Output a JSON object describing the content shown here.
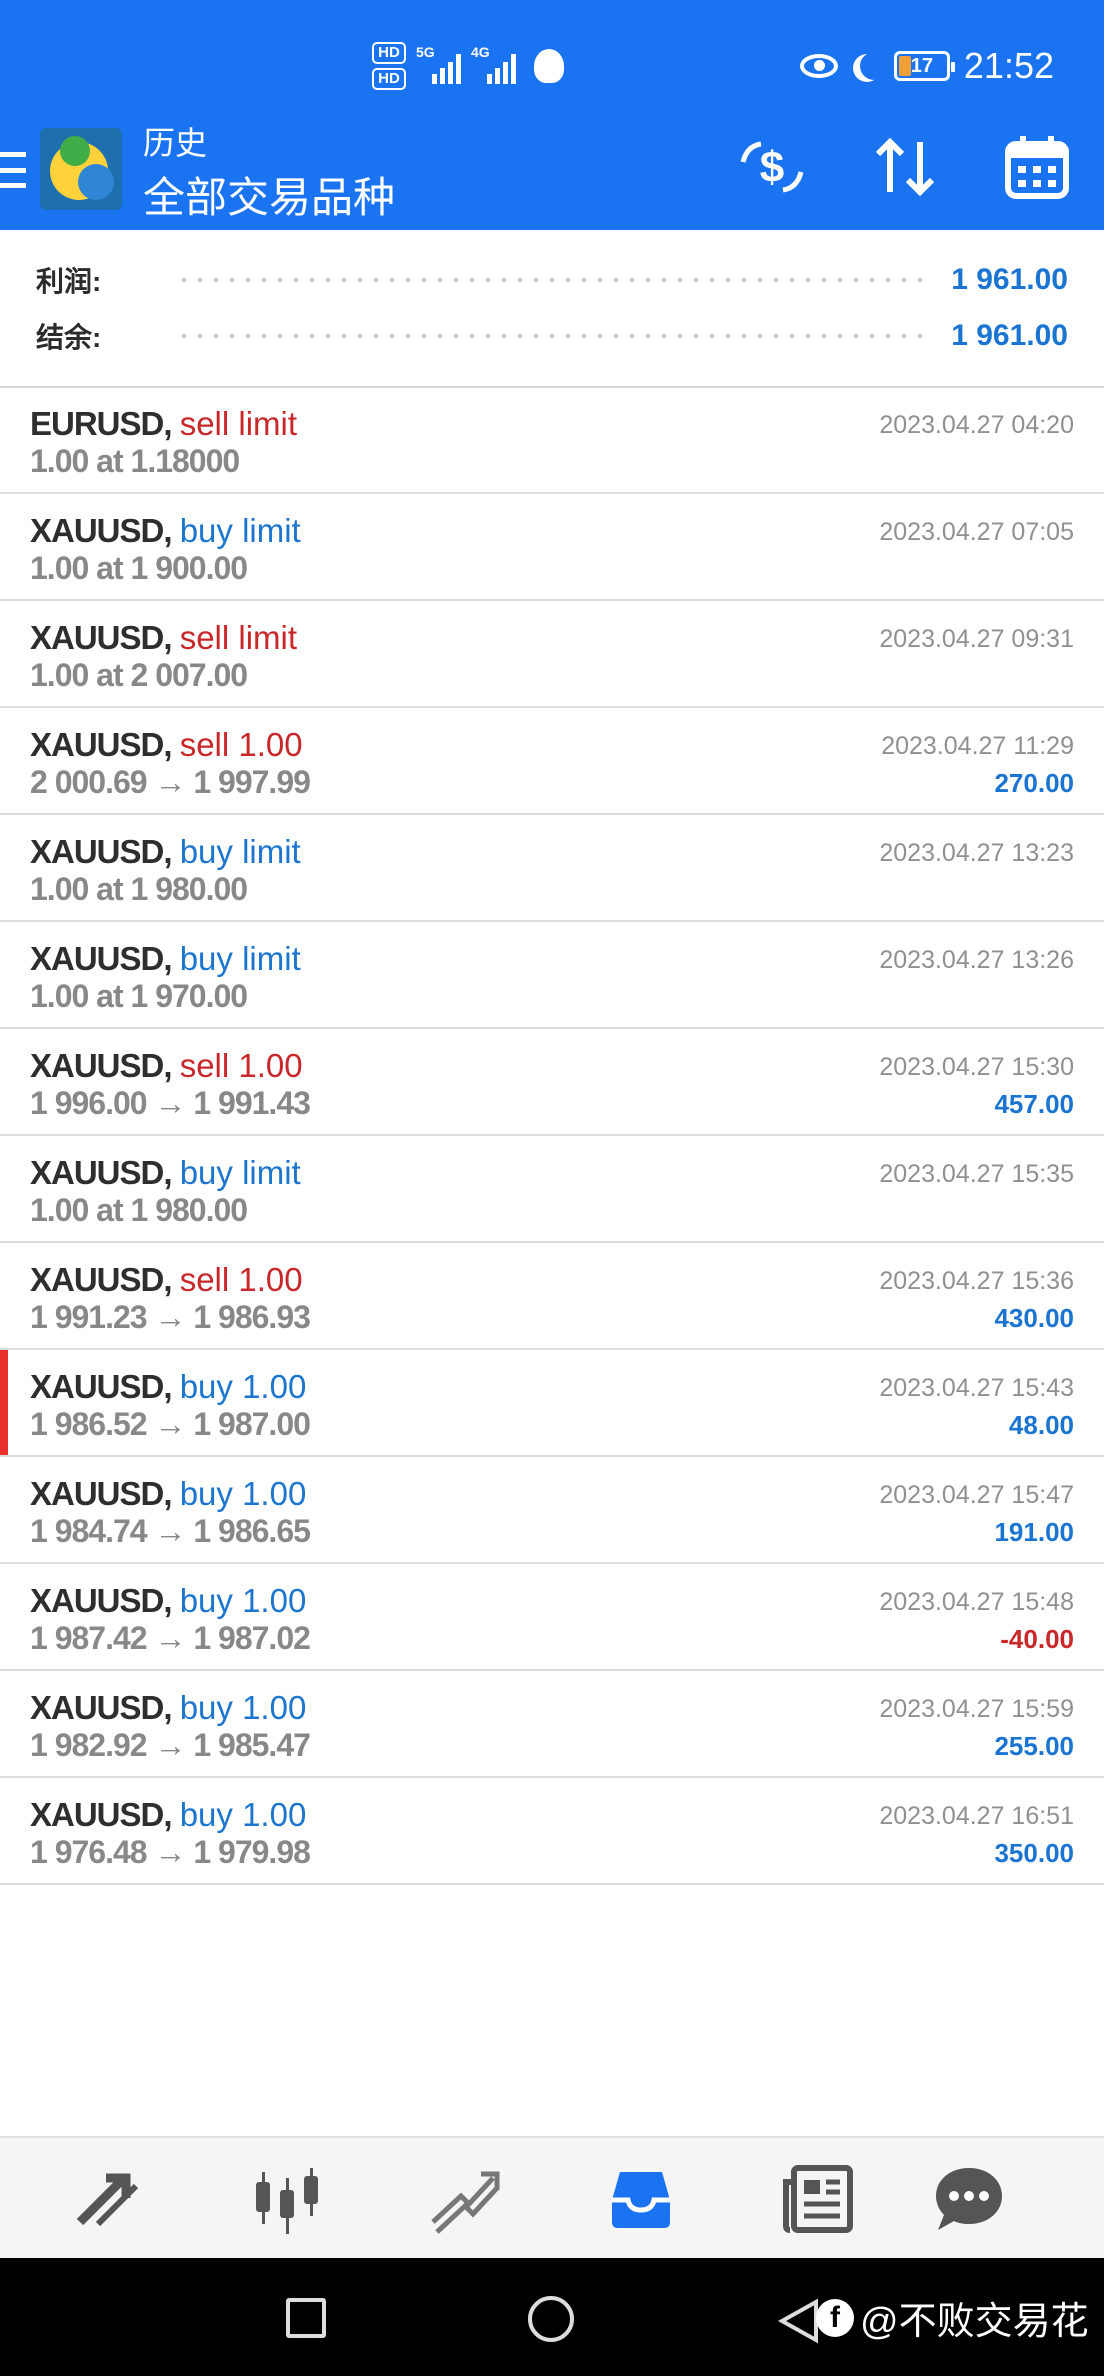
{
  "status_bar": {
    "hd1": "HD",
    "hd2": "HD",
    "net1": "5G",
    "net2": "4G",
    "battery": "17",
    "time": "21:52"
  },
  "header": {
    "title_small": "历史",
    "title_big": "全部交易品种"
  },
  "summary": {
    "profit_label": "利润:",
    "profit_value": "1 961.00",
    "balance_label": "结余:",
    "balance_value": "1 961.00"
  },
  "rows": [
    {
      "symbol": "EURUSD,",
      "type": "sell limit",
      "side": "sell",
      "prices": "1.00 at 1.18000",
      "time": "2023.04.27 04:20",
      "profit": ""
    },
    {
      "symbol": "XAUUSD,",
      "type": "buy limit",
      "side": "buy",
      "prices": "1.00 at 1 900.00",
      "time": "2023.04.27 07:05",
      "profit": ""
    },
    {
      "symbol": "XAUUSD,",
      "type": "sell limit",
      "side": "sell",
      "prices": "1.00 at 2 007.00",
      "time": "2023.04.27 09:31",
      "profit": ""
    },
    {
      "symbol": "XAUUSD,",
      "type": "sell 1.00",
      "side": "sell",
      "prices": "2 000.69 → 1 997.99",
      "time": "2023.04.27 11:29",
      "profit": "270.00"
    },
    {
      "symbol": "XAUUSD,",
      "type": "buy limit",
      "side": "buy",
      "prices": "1.00 at 1 980.00",
      "time": "2023.04.27 13:23",
      "profit": ""
    },
    {
      "symbol": "XAUUSD,",
      "type": "buy limit",
      "side": "buy",
      "prices": "1.00 at 1 970.00",
      "time": "2023.04.27 13:26",
      "profit": ""
    },
    {
      "symbol": "XAUUSD,",
      "type": "sell 1.00",
      "side": "sell",
      "prices": "1 996.00 → 1 991.43",
      "time": "2023.04.27 15:30",
      "profit": "457.00"
    },
    {
      "symbol": "XAUUSD,",
      "type": "buy limit",
      "side": "buy",
      "prices": "1.00 at 1 980.00",
      "time": "2023.04.27 15:35",
      "profit": ""
    },
    {
      "symbol": "XAUUSD,",
      "type": "sell 1.00",
      "side": "sell",
      "prices": "1 991.23 → 1 986.93",
      "time": "2023.04.27 15:36",
      "profit": "430.00"
    },
    {
      "symbol": "XAUUSD,",
      "type": "buy 1.00",
      "side": "buy",
      "prices": "1 986.52 → 1 987.00",
      "time": "2023.04.27 15:43",
      "profit": "48.00",
      "marked": true
    },
    {
      "symbol": "XAUUSD,",
      "type": "buy 1.00",
      "side": "buy",
      "prices": "1 984.74 → 1 986.65",
      "time": "2023.04.27 15:47",
      "profit": "191.00"
    },
    {
      "symbol": "XAUUSD,",
      "type": "buy 1.00",
      "side": "buy",
      "prices": "1 987.42 → 1 987.02",
      "time": "2023.04.27 15:48",
      "profit": "-40.00"
    },
    {
      "symbol": "XAUUSD,",
      "type": "buy 1.00",
      "side": "buy",
      "prices": "1 982.92 → 1 985.47",
      "time": "2023.04.27 15:59",
      "profit": "255.00"
    },
    {
      "symbol": "XAUUSD,",
      "type": "buy 1.00",
      "side": "buy",
      "prices": "1 976.48 → 1 979.98",
      "time": "2023.04.27 16:51",
      "profit": "350.00"
    }
  ],
  "bottom_nav": {
    "items": [
      "quotes-icon",
      "chart-icon",
      "trade-icon",
      "history-icon",
      "news-icon",
      "messages-icon"
    ],
    "active": "history-icon",
    "active_color": "#1a74f2"
  },
  "watermark": "@不败交易花",
  "colors": {
    "header": "#1a74f2",
    "sell": "#c8282a",
    "buy": "#1c75cf",
    "profit_positive": "#1a74d2",
    "profit_negative": "#c8282a"
  }
}
